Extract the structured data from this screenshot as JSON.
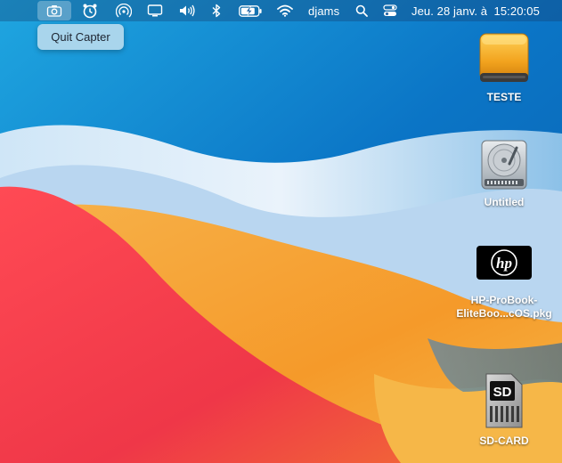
{
  "menubar": {
    "camera_icon": "camera-icon",
    "alarm_icon": "alarm-clock-icon",
    "airdrop_icon": "airdrop-icon",
    "display_icon": "display-icon",
    "volume_icon": "speaker-volume-icon",
    "bluetooth_icon": "bluetooth-icon",
    "battery_icon": "battery-charging-icon",
    "wifi_icon": "wifi-icon",
    "user_name": "djams",
    "search_icon": "spotlight-search-icon",
    "control_center_icon": "control-center-icon",
    "clock": "Jeu. 28 janv. à  15:20:05"
  },
  "tooltip": {
    "text": "Quit Capter"
  },
  "desktop": {
    "items": [
      {
        "label": "TESTE",
        "icon": "external-drive-icon"
      },
      {
        "label": "Untitled",
        "icon": "hard-disk-icon"
      },
      {
        "label_line1": "HP-ProBook-",
        "label_line2": "EliteBoo...cOS.pkg",
        "icon": "hp-package-icon"
      },
      {
        "label": "SD-CARD",
        "icon": "sd-card-icon"
      }
    ]
  },
  "colors": {
    "wallpaper_blue": "#0f74c4",
    "wallpaper_orange": "#f6a12f",
    "wallpaper_red": "#ef3f4d",
    "drive_orange": "#f0a020",
    "tooltip_bg": "#a9d5ec"
  }
}
